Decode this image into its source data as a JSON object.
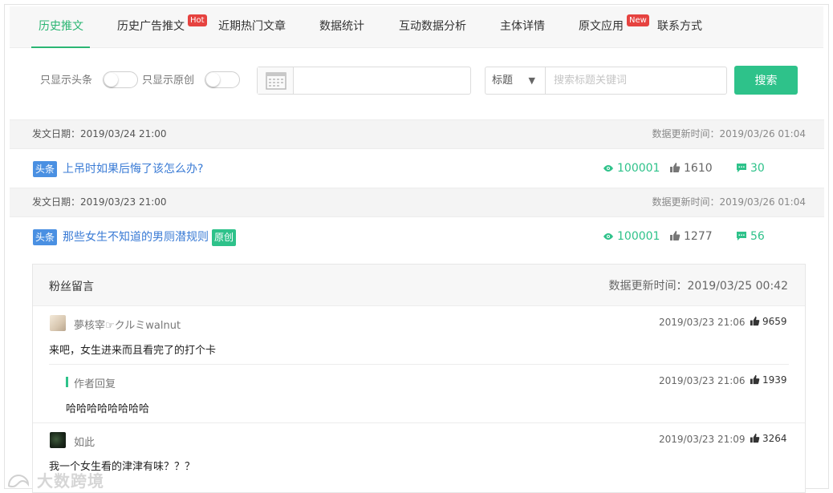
{
  "tabs": [
    {
      "label": "历史推文",
      "active": true
    },
    {
      "label": "历史广告推文",
      "badge": "Hot"
    },
    {
      "label": "近期热门文章"
    },
    {
      "label": "数据统计"
    },
    {
      "label": "互动数据分析"
    },
    {
      "label": "主体详情"
    },
    {
      "label": "原文应用",
      "badge": "New"
    },
    {
      "label": "联系方式"
    }
  ],
  "filter": {
    "headline_only_label": "只显示头条",
    "original_only_label": "只显示原创",
    "date_value": "",
    "select_value": "标题",
    "search_placeholder": "搜索标题关键词",
    "search_button": "搜索"
  },
  "articles": [
    {
      "publish": "发文日期：2019/03/24 21:00",
      "updated": "数据更新时间：2019/03/26 01:04",
      "tag": "头条",
      "title": "上吊时如果后悔了该怎么办?",
      "views": "100001",
      "likes": "1610",
      "comments": "30"
    },
    {
      "publish": "发文日期：2019/03/23 21:00",
      "updated": "数据更新时间：2019/03/26 01:04",
      "tag": "头条",
      "title": "那些女生不知道的男厕潜规则",
      "original_tag": "原创",
      "views": "100001",
      "likes": "1277",
      "comments": "56"
    }
  ],
  "fan_comments": {
    "title": "粉丝留言",
    "updated": "数据更新时间：2019/03/25 00:42",
    "items": [
      {
        "user": "夢核宰☞クルミwalnut",
        "text": "来吧，女生进来而且看完了的打个卡",
        "time": "2019/03/23 21:06",
        "likes": "9659"
      },
      {
        "reply_label": "作者回复",
        "text": "哈哈哈哈哈哈哈哈",
        "time": "2019/03/23 21:06",
        "likes": "1939"
      },
      {
        "user": "如此",
        "text": "我一个女生看的津津有味？？？",
        "time": "2019/03/23 21:09",
        "likes": "3264"
      }
    ]
  },
  "watermark": "大数跨境",
  "colors": {
    "accent": "#2bb673",
    "link": "#3a7bd5",
    "headline_tag": "#4a90e2",
    "badge_red": "#e64340"
  }
}
